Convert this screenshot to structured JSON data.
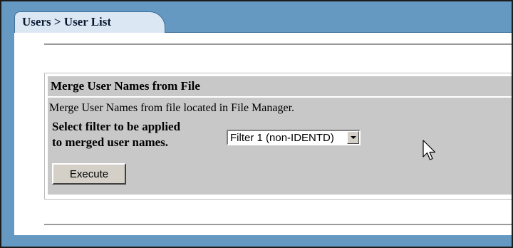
{
  "breadcrumb": {
    "text": "Users > User List"
  },
  "panel": {
    "title": "Merge User Names from File",
    "description": "Merge User Names from file located in File Manager.",
    "filter_label_line1": "Select filter to be applied",
    "filter_label_line2": "to merged user names.",
    "filter_select": {
      "selected": "Filter 1 (non-IDENTD)"
    },
    "execute_label": "Execute"
  },
  "colors": {
    "frame_blue": "#6699c2",
    "tab_background": "#dbe8f3",
    "panel_gray": "#c8c8c8"
  },
  "icons": {
    "cursor": "mouse-pointer-icon",
    "dropdown": "dropdown-arrow-icon"
  }
}
